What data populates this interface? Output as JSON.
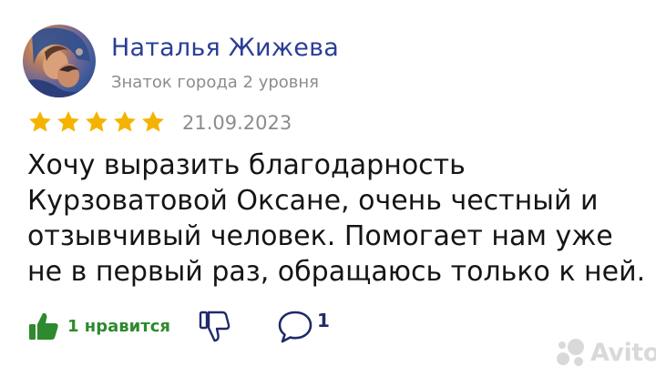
{
  "author": {
    "name": "Наталья Жижева",
    "rank": "Знаток города 2 уровня"
  },
  "rating": {
    "value": 5,
    "max": 5
  },
  "date": "21.09.2023",
  "review_text": {
    "line1": "Хочу выразить благодарность",
    "line2": "Курзоватовой Оксане, очень честный и",
    "line3": "отзывчивый человек. Помогает нам уже",
    "line4": "не в первый раз, обращаюсь только к ней."
  },
  "actions": {
    "like_label": "1 нравится",
    "comment_count": "1"
  },
  "watermark": {
    "text": "Avito"
  },
  "colors": {
    "author_name": "#2a3e96",
    "star": "#f5b301",
    "like_green": "#2e8a2e",
    "muted_text": "#8c8c8c",
    "icon_dark": "#1f2a6b",
    "watermark": "#d9d9d9"
  },
  "icons": {
    "like": "thumbs-up-icon",
    "dislike": "thumbs-down-icon",
    "comment": "speech-bubble-icon",
    "watermark": "avito-logo-icon"
  }
}
